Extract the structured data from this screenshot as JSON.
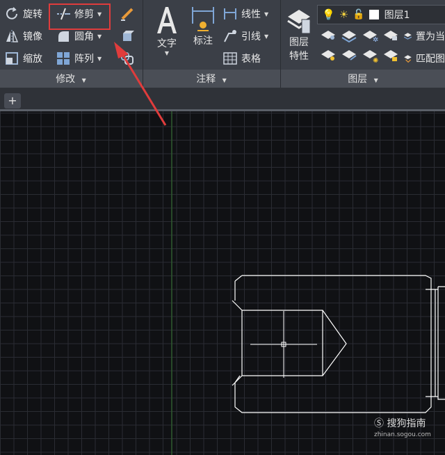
{
  "ribbon": {
    "modify": {
      "title": "修改",
      "rotate": "旋转",
      "trim": "修剪",
      "mirror": "镜像",
      "fillet": "圆角",
      "scale": "缩放",
      "array": "阵列"
    },
    "annotation": {
      "title": "注释",
      "text": "文字",
      "dimension": "标注",
      "linear": "线性",
      "leader": "引线",
      "table": "表格"
    },
    "layers": {
      "title": "图层",
      "properties_line1": "图层",
      "properties_line2": "特性",
      "current_layer": "图层1",
      "set_current": "置为当",
      "match": "匹配图"
    }
  },
  "tabs": {
    "add": "+"
  },
  "watermark": {
    "brand": "搜狗指南",
    "url": "zhinan.sogou.com"
  },
  "colors": {
    "ribbon_bg": "#3b3f47",
    "canvas_bg": "#101114",
    "grid": "#2a2c33",
    "highlight": "#e03c3c",
    "axis_green": "#2f5a2f",
    "drawing": "#ffffff"
  }
}
